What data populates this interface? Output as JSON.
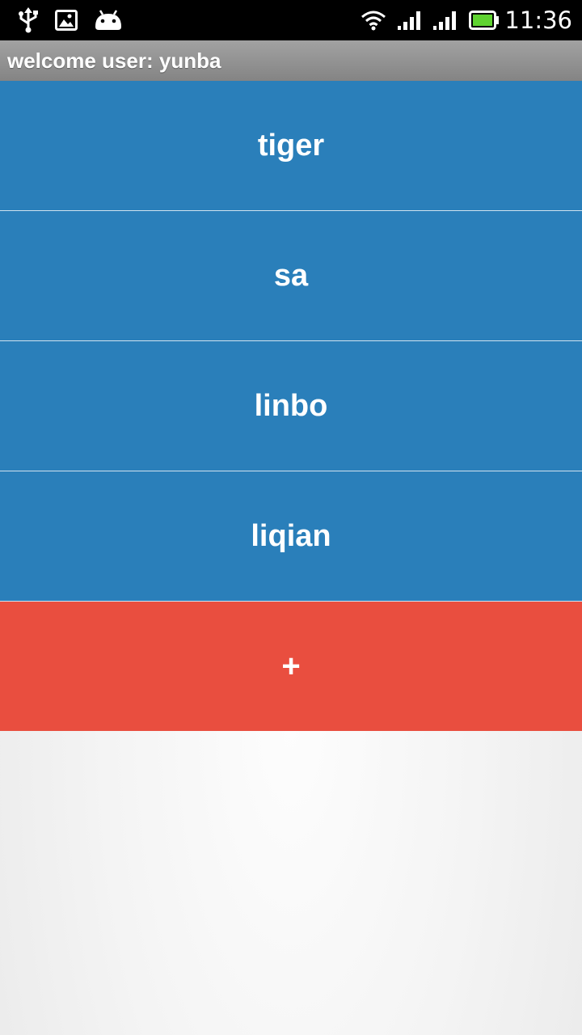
{
  "status_bar": {
    "left_icons": [
      "usb-icon",
      "image-notification-icon",
      "android-icon"
    ],
    "right_icons": [
      "wifi-icon",
      "signal-icon",
      "signal-icon-2",
      "battery-icon"
    ],
    "time": "11:36"
  },
  "title_bar": {
    "title": "welcome user: yunba"
  },
  "users": [
    {
      "name": "tiger"
    },
    {
      "name": "sa"
    },
    {
      "name": "linbo"
    },
    {
      "name": "liqian"
    }
  ],
  "add_button": {
    "label": "+"
  },
  "colors": {
    "list_item": "#2a7fba",
    "add_button": "#e94e3f",
    "title_bar": "#939393",
    "battery": "#5fd330"
  }
}
